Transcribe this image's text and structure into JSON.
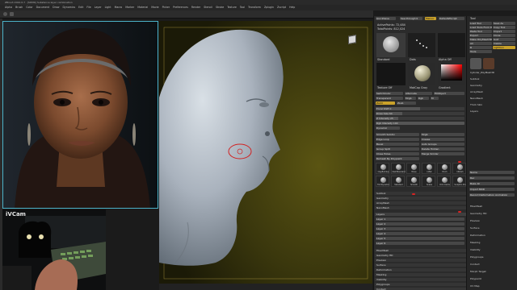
{
  "app": {
    "title": "ZBrush 2022.0.7 · [SDMK] Substance layer combination"
  },
  "menubar": [
    "Alpha",
    "Brush",
    "Color",
    "Document",
    "Draw",
    "Dynamics",
    "Edit",
    "File",
    "Layer",
    "Light",
    "Macro",
    "Marker",
    "Material",
    "Movie",
    "Picker",
    "Preferences",
    "Render",
    "Stencil",
    "Stroke",
    "Texture",
    "Tool",
    "Transform",
    "Zplugin",
    "Zscript",
    "Help"
  ],
  "left_panel": {
    "webcam_label": "iVCam"
  },
  "panel": {
    "header": [
      "QuickSave",
      "See-through 0",
      "Menus",
      "DefaultZScript"
    ],
    "hd_label": "Buffer",
    "active_points": "ActivePoints: 72,484",
    "total_points": "TotalPoints: 812,024",
    "brush_label": "Standard",
    "stroke_label": "Dots",
    "alpha_label": "Alpha Off",
    "texture_label": "Texture Off",
    "material_label": "MatCap Gray",
    "gradient_label": "Gradient",
    "switch_color": "SwitchColor",
    "alternate": "Alternate",
    "transparent": "Transparent",
    "fill_object": "FillObject",
    "mrgb": "Mrgb",
    "rgb": "Rgb",
    "m": "M",
    "zadd": "Zadd",
    "zsub": "Zsub",
    "focal": "Focal Shift 0",
    "draw_size": "Draw Size 64",
    "z_intensity": "Z Intensity 25",
    "rgb_intensity": "Rgb Intensity 100",
    "dynamic": "Dynamic",
    "sections": [
      "Subtool",
      "Geometry",
      "ArrayMesh",
      "NanoMesh",
      "Thick Skin",
      "Layers",
      "FiberMesh",
      "Geometry HD",
      "Preview",
      "Surface",
      "Deformation",
      "Masking",
      "Visibility",
      "Polygroups",
      "Contact",
      "Morph Target",
      "Polypaint",
      "UV Map",
      "Texture Map"
    ],
    "layers_title": "Layers",
    "layer_items": [
      "Layer 1",
      "Layer 2",
      "Layer 3",
      "Layer 4",
      "Layer 5",
      "Layer 6"
    ],
    "brushes": [
      "ClayBuildup",
      "DamStandard",
      "Move",
      "Inflat",
      "Pinch",
      "hPolish",
      "TrimDynamic",
      "Standard",
      "Smooth",
      "Snake",
      "Orb Cracks",
      "Sculptris Pro"
    ],
    "smooth_sliders": [
      "Smooth Subdiv",
      "Mrgb",
      "Edge Loop",
      "Crease",
      "Bevel",
      "Auto Groups",
      "Group Split",
      "Delete Hidden",
      "Close Holes",
      "Merge Similar",
      "Remesh By Polypaint"
    ]
  },
  "lightbox": {
    "title": "Tool",
    "buttons": [
      "Load Tool",
      "Save As",
      "Load Tools From Project",
      "Copy Tool",
      "Paste Tool",
      "Import",
      "Export",
      "Clone",
      "Make PolyMesh3D",
      "GoZ",
      "All",
      "Visible",
      "R",
      "Lightbox",
      "Tools"
    ],
    "tool_name": "Cylinder_PolyMesh3D",
    "sections": [
      "Subtool",
      "Geometry",
      "ArrayMesh",
      "NanoMesh",
      "Thick Skin",
      "Layers",
      "FiberMesh",
      "Geometry HD",
      "Preview",
      "Surface",
      "Deformation",
      "Masking",
      "Visibility",
      "Polygroups",
      "Contact",
      "Morph Target",
      "Polypaint",
      "UV Map",
      "Texture Map"
    ],
    "layer_labels": [
      "Name",
      "Rec",
      "Bake All",
      "Import MDD",
      "Record Deformation Animation"
    ]
  },
  "colors": {
    "accent": "#c9a12a",
    "canvas_bg": "#2a2810",
    "portrait_border": "#4bb2c8",
    "highlight": "#d22222",
    "clay": "#a9b2bd"
  }
}
